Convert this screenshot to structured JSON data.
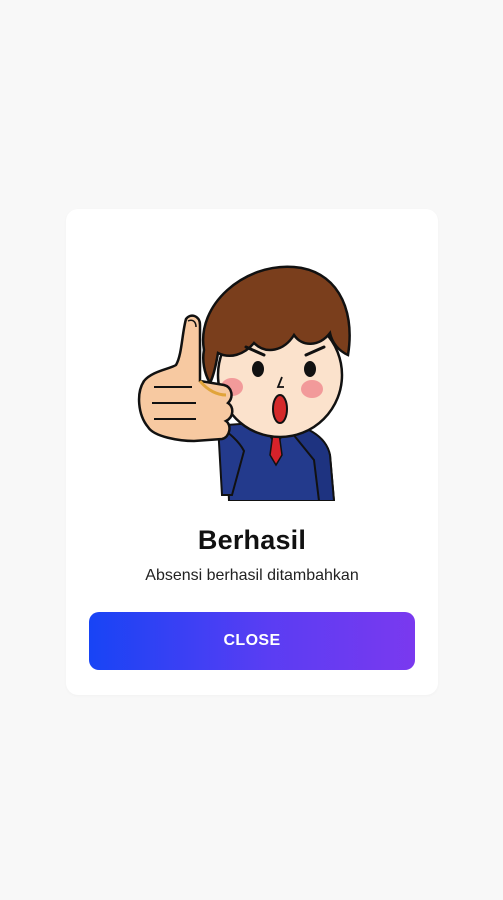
{
  "dialog": {
    "illustration_icon": "thumbs-up-businessman-illustration",
    "title": "Berhasil",
    "message": "Absensi berhasil ditambahkan",
    "close_label": "CLOSE"
  },
  "colors": {
    "background": "#f8f8f8",
    "dialog": "#ffffff",
    "button_gradient_start": "#1844f5",
    "button_gradient_end": "#7a39ef",
    "button_text": "#ffffff",
    "title": "#111111"
  }
}
